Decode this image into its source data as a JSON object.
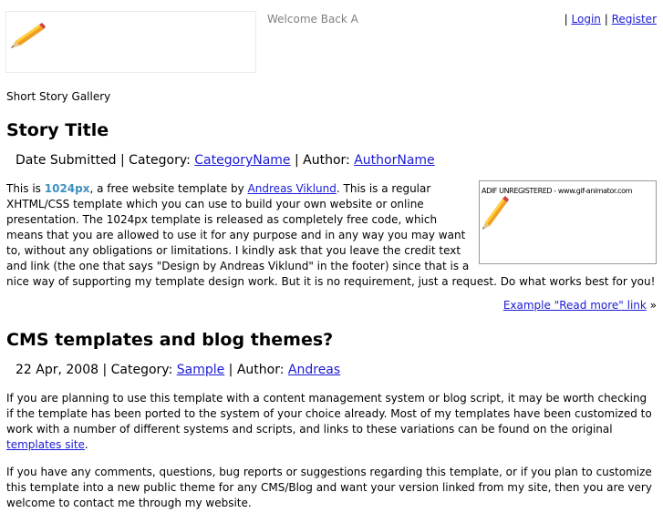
{
  "header": {
    "welcome": "Welcome Back A",
    "sep1": "|",
    "login": "Login",
    "sep2": "|",
    "register": "Register"
  },
  "gallery_label": "Short Story Gallery",
  "post1": {
    "title": "Story Title",
    "meta_prefix": "Date Submitted | Category: ",
    "category": "CategoryName",
    "meta_mid": " | Author: ",
    "author": "AuthorName",
    "thumb_text": "ADIF UNREGISTERED - www.gif-animator.com",
    "p1_a": "This is ",
    "p1_brand": "1024px",
    "p1_b": ", a free website template by ",
    "p1_link": "Andreas Viklund",
    "p1_c": ". This is a regular XHTML/CSS template which you can use to build your own website or online presentation. The 1024px template is released as completely free code, which means that you are allowed to use it for any purpose and in any way you may want to, without any obligations or limitations. I kindly ask that you leave the credit text and link (the one that says \"Design by Andreas Viklund\" in the footer) since that is a nice way of supporting my template design work. But it is no requirement, just a request. Do what works best for you!",
    "read_more": "Example \"Read more\" link",
    "read_more_suffix": " »"
  },
  "post2": {
    "title": "CMS templates and blog themes?",
    "meta_prefix": "22 Apr, 2008 | Category: ",
    "category": "Sample",
    "meta_mid": " | Author: ",
    "author": "Andreas",
    "p1_a": "If you are planning to use this template with a content management system or blog script, it may be worth checking if the template has been ported to the system of your choice already. Most of my templates have been customized to work with a number of different systems and scripts, and links to these variations can be found on the original ",
    "p1_link": "templates site",
    "p1_b": ".",
    "p2": "If you have any comments, questions, bug reports or suggestions regarding this template, or if you plan to customize this template into a new public theme for any CMS/Blog and want your version linked from my site, then you are very welcome to contact me through my website."
  },
  "colors": {
    "link": "#1a1ad6",
    "brand": "#3f8fbf",
    "muted": "#7f7f7f"
  }
}
